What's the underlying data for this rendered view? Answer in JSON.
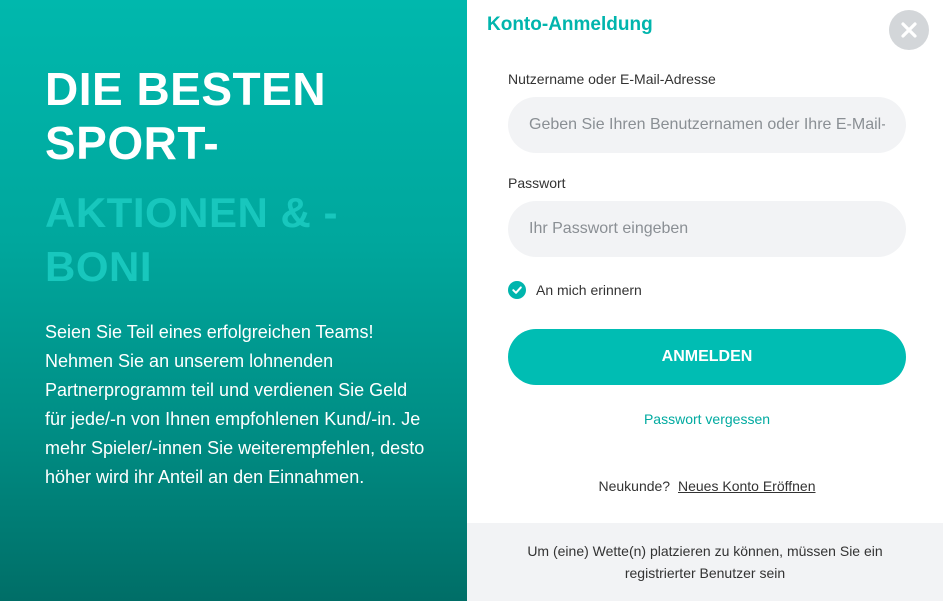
{
  "promo": {
    "headline_line1": "DIE BESTEN",
    "headline_line2": "SPORT-",
    "headline_accent_line1": "AKTIONEN & -",
    "headline_accent_line2": "BONI",
    "body": "Seien Sie Teil eines erfolgreichen Teams! Nehmen Sie an unserem lohnenden Partnerprogramm teil und verdienen Sie Geld für jede/-n von Ihnen empfohlenen Kund/-in. Je mehr Spieler/-innen Sie weiterempfehlen, desto höher wird ihr Anteil an den Einnahmen."
  },
  "login": {
    "title": "Konto-Anmeldung",
    "close_icon": "close-icon",
    "username_label": "Nutzername oder E-Mail-Adresse",
    "username_placeholder": "Geben Sie Ihren Benutzernamen oder Ihre E-Mail-Adresse ein",
    "username_value": "",
    "password_label": "Passwort",
    "password_placeholder": "Ihr Passwort eingeben",
    "password_value": "",
    "remember_label": "An mich erinnern",
    "remember_checked": true,
    "submit_label": "ANMELDEN",
    "forgot_label": "Passwort vergessen",
    "new_customer_text": "Neukunde?",
    "new_account_link": "Neues Konto Eröffnen",
    "footer_note": "Um (eine) Wette(n) platzieren zu können, müssen Sie ein registrierter Benutzer sein"
  },
  "colors": {
    "accent": "#00bdb3",
    "accent_text": "#00b5ad",
    "panel_gradient_top": "#00b8ad",
    "panel_gradient_bottom": "#006e67",
    "input_bg": "#f2f3f5",
    "close_bg": "#d3d6d9"
  }
}
